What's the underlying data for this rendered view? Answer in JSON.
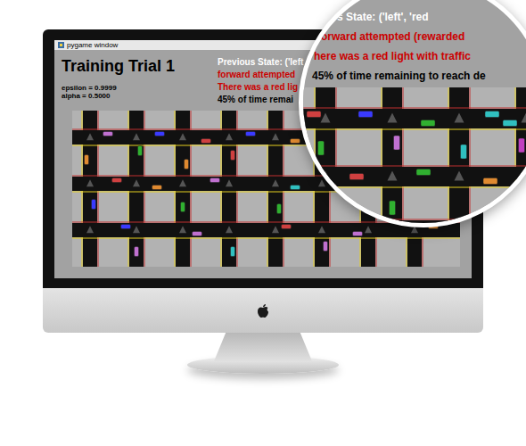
{
  "window": {
    "title": "pygame window"
  },
  "trial_title": "Training Trial 1",
  "params": [
    "epsilon = 0.9999",
    "alpha = 0.5000"
  ],
  "status_lines": [
    {
      "text": "Previous State: ('left",
      "color": "#ffffff"
    },
    {
      "text": "forward attempted",
      "color": "#cc0000"
    },
    {
      "text": "There was a red lig",
      "color": "#cc0000"
    },
    {
      "text": "45% of time remai",
      "color": "#000000"
    }
  ],
  "cars": [
    {
      "color": "#c070d0"
    },
    {
      "color": "#3a3aff"
    },
    {
      "color": "#d04040"
    },
    {
      "color": "#3a3aff"
    },
    {
      "color": "#e08a30"
    },
    {
      "color": "#c070d0"
    },
    {
      "color": "#30c0c0"
    },
    {
      "color": "#e08a30"
    },
    {
      "color": "#30b030"
    },
    {
      "color": "#e08a30"
    },
    {
      "color": "#d04040"
    },
    {
      "color": "#30b030"
    },
    {
      "color": "#30c0c0"
    },
    {
      "color": "#d04040"
    },
    {
      "color": "#e08a30"
    },
    {
      "color": "#c070d0"
    },
    {
      "color": "#30c0c0"
    },
    {
      "color": "#30b030"
    },
    {
      "color": "#e08a30"
    },
    {
      "color": "#3a3aff"
    },
    {
      "color": "#30b030"
    },
    {
      "color": "#30b030"
    },
    {
      "color": "#30c0c0"
    },
    {
      "color": "#3a3aff"
    },
    {
      "color": "#c070d0"
    },
    {
      "color": "#d04040"
    },
    {
      "color": "#c070d0"
    },
    {
      "color": "#e08a30"
    },
    {
      "color": "#c070d0"
    },
    {
      "color": "#30c0c0"
    },
    {
      "color": "#c070d0"
    }
  ],
  "magnifier": {
    "status_lines": [
      {
        "text": "s State: ('left', 'red",
        "color": "#ffffff"
      },
      {
        "text": "forward attempted (rewarded",
        "color": "#cc0000"
      },
      {
        "text": "here was a red light with traffic",
        "color": "#cc0000"
      },
      {
        "text": "45% of time remaining to reach de",
        "color": "#000000"
      }
    ],
    "cars": [
      {
        "color": "#d04040"
      },
      {
        "color": "#3a3aff"
      },
      {
        "color": "#30b030"
      },
      {
        "color": "#30c0c0"
      },
      {
        "color": "#30c0c0"
      },
      {
        "color": "#30b030"
      },
      {
        "color": "#c070d0"
      },
      {
        "color": "#30c0c0"
      },
      {
        "color": "#c040c0"
      },
      {
        "color": "#30c0c0"
      },
      {
        "color": "#d04040"
      },
      {
        "color": "#30b030"
      },
      {
        "color": "#e08a30"
      },
      {
        "color": "#30b030"
      },
      {
        "color": "#c070d0"
      }
    ]
  }
}
